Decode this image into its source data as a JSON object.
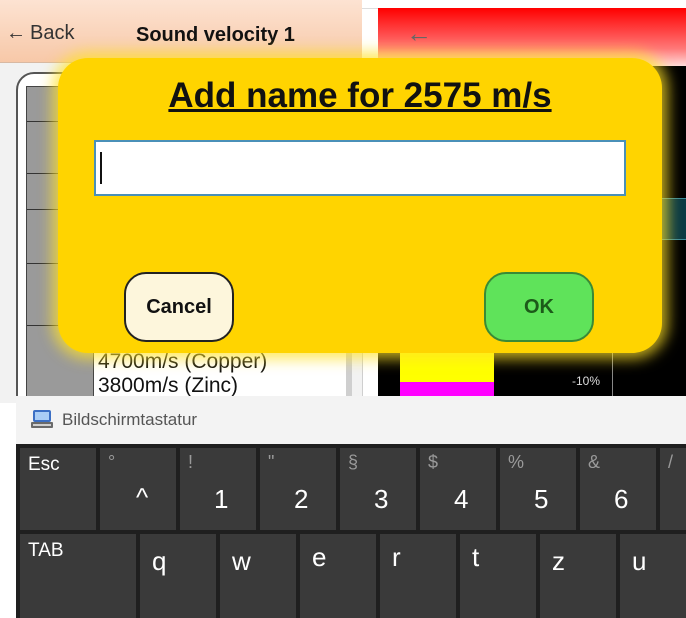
{
  "left_window": {
    "back_label": "Back",
    "title": "Sound velocity 1",
    "list_visible": [
      "4700m/s (Copper)",
      "3800m/s (Zinc)"
    ]
  },
  "right_window": {
    "percent_label": "-10%"
  },
  "dialog": {
    "title": "Add name for 2575 m/s",
    "input_value": "",
    "cancel_label": "Cancel",
    "ok_label": "OK"
  },
  "keyboard": {
    "title": "Bildschirmtastatur",
    "row1": [
      {
        "shift": "°",
        "main": "^",
        "label": "Esc"
      },
      {
        "shift": "°",
        "main": "^"
      },
      {
        "shift": "!",
        "main": "1"
      },
      {
        "shift": "\"",
        "main": "2"
      },
      {
        "shift": "§",
        "main": "3"
      },
      {
        "shift": "$",
        "main": "4"
      },
      {
        "shift": "%",
        "main": "5"
      },
      {
        "shift": "&",
        "main": "6"
      },
      {
        "shift": "/",
        "main": ""
      }
    ],
    "row2": [
      {
        "label": "TAB"
      },
      {
        "main": "q"
      },
      {
        "main": "w"
      },
      {
        "main": "e"
      },
      {
        "main": "r"
      },
      {
        "main": "t"
      },
      {
        "main": "z"
      },
      {
        "main": "u"
      }
    ]
  },
  "colors": {
    "dialog_bg": "#ffd400",
    "ok_bg": "#5fe35a",
    "cancel_bg": "#fdf6dc",
    "header_red": "#ff0000"
  }
}
